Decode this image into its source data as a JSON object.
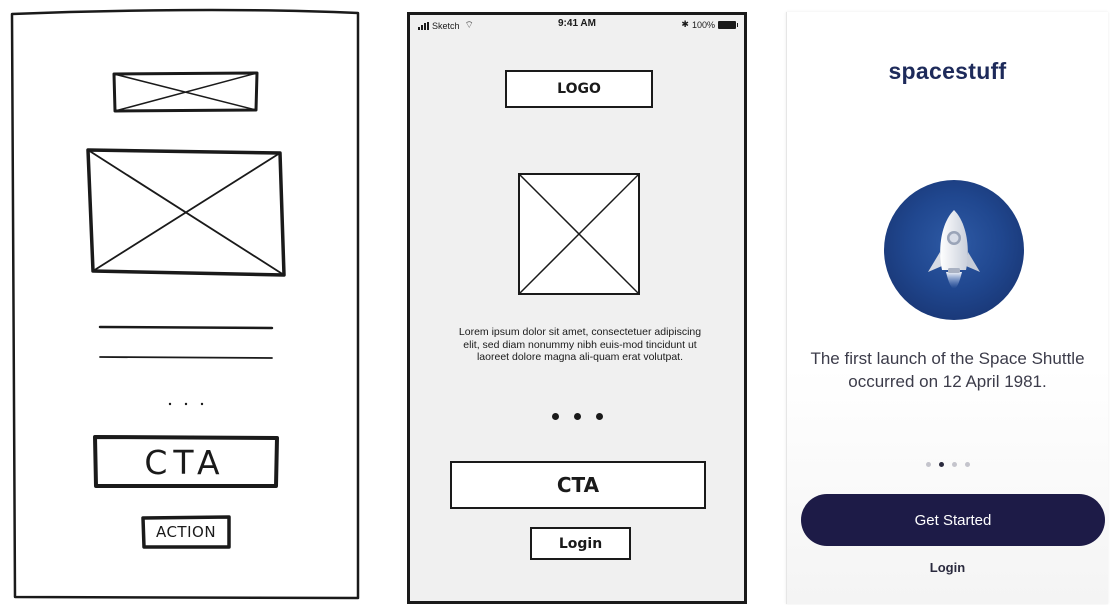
{
  "sketch": {
    "cta_label": "CTA",
    "action_label": "ACTION",
    "dots": "..."
  },
  "wireframe": {
    "status": {
      "carrier": "Sketch",
      "time": "9:41 AM",
      "battery": "100%",
      "icons": [
        "signal-icon",
        "wifi-icon",
        "bluetooth-icon",
        "battery-icon"
      ]
    },
    "logo_label": "LOGO",
    "body_text": "Lorem ipsum dolor sit amet, consectetuer adipiscing elit, sed diam nonummy nibh euis-mod tincidunt ut laoreet dolore magna ali-quam erat volutpat.",
    "cta_label": "CTA",
    "login_label": "Login"
  },
  "mockup": {
    "brand": "spacestuff",
    "fact": "The first launch of the Space Shuttle occurred on 12 April 1981.",
    "pager": {
      "count": 4,
      "active": 2
    },
    "primary_button": "Get Started",
    "login_label": "Login",
    "colors": {
      "brand_text": "#1d2a5a",
      "button_bg": "#1d1b47",
      "badge_blue": "#20478f"
    }
  }
}
